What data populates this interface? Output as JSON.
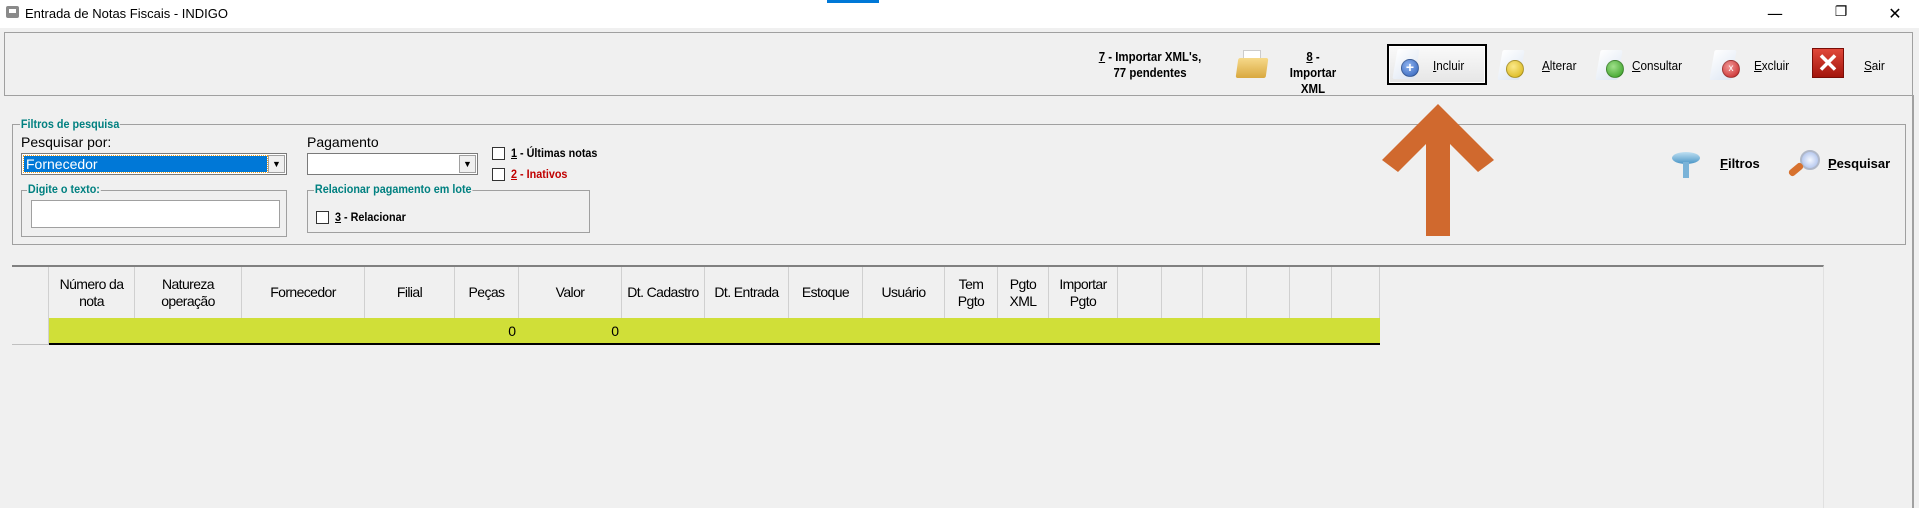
{
  "window": {
    "title": "Entrada de Notas Fiscais - INDIGO",
    "minimize": "—",
    "restore": "❐",
    "close": "✕"
  },
  "toolbar": {
    "import_xmls": {
      "key": "7",
      "line1": " - Importar XML's,",
      "line2": "77 pendentes"
    },
    "import_xml": {
      "key": "8",
      "line1": " - Importar",
      "line2": "XML"
    },
    "incluir": {
      "key": "I",
      "rest": "ncluir"
    },
    "alterar": {
      "key": "A",
      "rest": "lterar"
    },
    "consultar": {
      "key": "C",
      "rest": "onsultar"
    },
    "excluir": {
      "key": "E",
      "rest": "xcluir"
    },
    "sair": {
      "key": "S",
      "rest": "air"
    }
  },
  "filters": {
    "legend": "Filtros de pesquisa",
    "search_by_label": "Pesquisar por:",
    "search_by_value": "Fornecedor",
    "payment_label": "Pagamento",
    "payment_value": "",
    "ultimas": {
      "key": "1",
      "rest": " - Últimas notas",
      "checked": false
    },
    "inativos": {
      "key": "2",
      "rest": " - Inativos",
      "checked": false
    },
    "text_legend": "Digite o texto:",
    "text_value": "",
    "lote_legend": "Relacionar pagamento em lote",
    "relacionar": {
      "key": "3",
      "rest": " - Relacionar",
      "checked": false
    },
    "filtros": {
      "key": "F",
      "rest": "iltros"
    },
    "pesquisar": {
      "key": "P",
      "rest": "esquisar"
    }
  },
  "colors": {
    "row_highlight": "#d0df38",
    "arrow": "#d0692e",
    "selection": "#0078d7"
  },
  "grid": {
    "columns": [
      "Número da nota",
      "Natureza operação",
      "Fornecedor",
      "Filial",
      "Peças",
      "Valor",
      "Dt. Cadastro",
      "Dt. Entrada",
      "Estoque",
      "Usuário",
      "Tem Pgto",
      "Pgto XML",
      "Importar Pgto",
      "",
      "",
      "",
      "",
      "",
      ""
    ],
    "rows": [
      [
        "",
        "",
        "",
        "",
        "0",
        "0",
        "",
        "",
        "",
        "",
        "",
        "",
        "",
        "",
        "",
        "",
        "",
        "",
        ""
      ]
    ]
  }
}
